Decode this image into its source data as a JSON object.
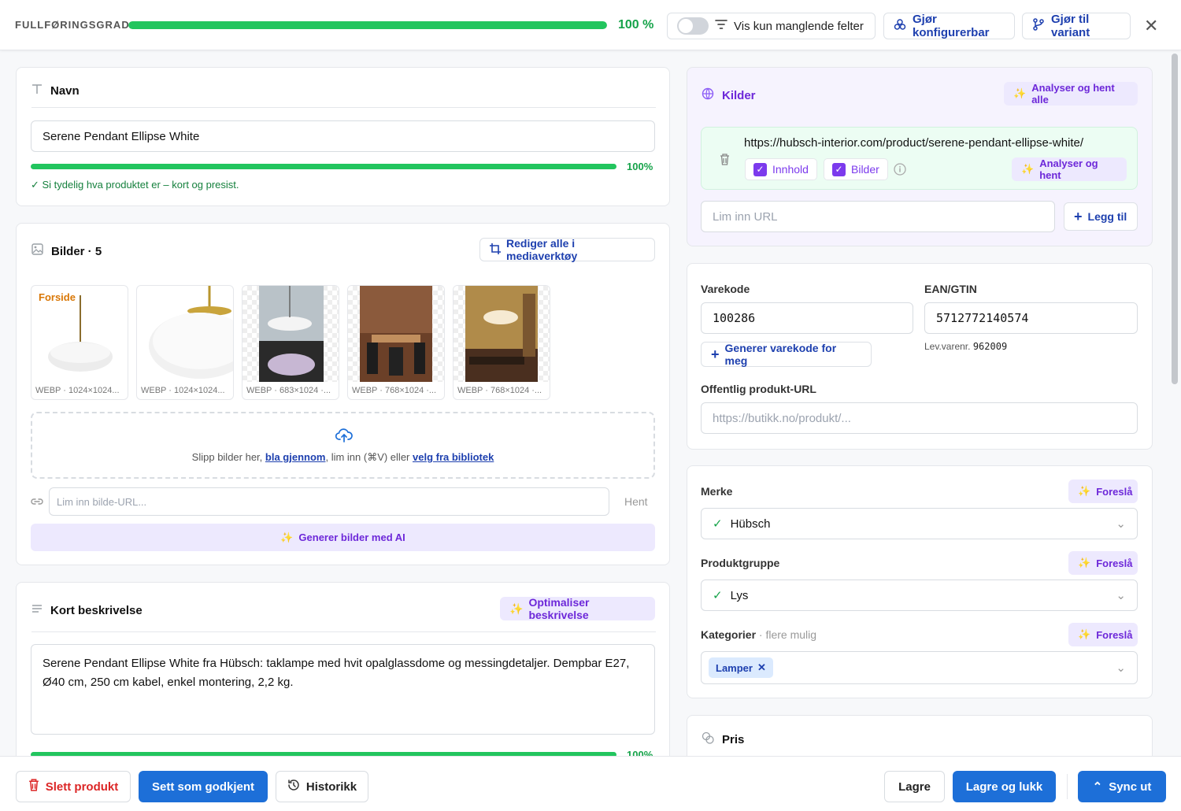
{
  "topbar": {
    "completion_label": "FULLFØRINGSGRAD",
    "completion_value": 1.0,
    "completion_pct": "100 %",
    "toggle_label": "Vis kun manglende felter",
    "configurable_label": "Gjør konfigurerbar",
    "variant_label": "Gjør til variant",
    "close_icon": "close-icon"
  },
  "name_card": {
    "title": "Navn",
    "value": "Serene Pendant Ellipse White",
    "score_pct": "100%",
    "hint": "✓ Si tydelig hva produktet er – kort og presist."
  },
  "images_card": {
    "title": "Bilder · 5",
    "edit_all_label": "Rediger alle i mediaverktøy",
    "front_badge": "Forside",
    "thumbs": [
      {
        "caption": "WEBP · 1024×1024..."
      },
      {
        "caption": "WEBP · 1024×1024..."
      },
      {
        "caption": "WEBP · 683×1024 ·..."
      },
      {
        "caption": "WEBP · 768×1024 ·..."
      },
      {
        "caption": "WEBP · 768×1024 ·..."
      }
    ],
    "drop_prefix": "Slipp bilder her, ",
    "drop_browse": "bla gjennom",
    "drop_middle": ", lim inn (⌘V) eller ",
    "drop_library": "velg fra bibliotek",
    "url_placeholder": "Lim inn bilde-URL...",
    "fetch_label": "Hent",
    "ai_label": "Generer bilder med AI"
  },
  "desc_card": {
    "title": "Kort beskrivelse",
    "optimize_label": "Optimaliser beskrivelse",
    "text": "Serene Pendant Ellipse White fra Hübsch: taklampe med hvit opalglassdome og messingdetaljer. Dempbar E27, Ø40 cm, 250 cm kabel, enkel montering, 2,2 kg.",
    "score_pct": "100%"
  },
  "sources_card": {
    "title": "Kilder",
    "analyze_all_label": "Analyser og hent alle",
    "source_url": "https://hubsch-interior.com/product/serene-pendant-ellipse-white/",
    "content_label": "Innhold",
    "images_label": "Bilder",
    "analyze_label": "Analyser og hent",
    "url_placeholder": "Lim inn URL",
    "add_label": "Legg til"
  },
  "codes_card": {
    "sku_label": "Varekode",
    "sku_value": "100286",
    "ean_label": "EAN/GTIN",
    "ean_value": "5712772140574",
    "generate_label": "Generer varekode for meg",
    "supplier_prefix": "Lev.varenr.",
    "supplier_value": "962009",
    "public_url_label": "Offentlig produkt-URL",
    "public_url_placeholder": "https://butikk.no/produkt/..."
  },
  "classify_card": {
    "brand_label": "Merke",
    "brand_value": "Hübsch",
    "group_label": "Produktgruppe",
    "group_value": "Lys",
    "categories_label": "Kategorier",
    "categories_sub": "· flere mulig",
    "suggest_label": "Foreslå",
    "category_chip": "Lamper"
  },
  "price_card": {
    "title": "Pris"
  },
  "footer": {
    "delete_label": "Slett produkt",
    "approve_label": "Sett som godkjent",
    "history_label": "Historikk",
    "save_label": "Lagre",
    "save_close_label": "Lagre og lukk",
    "sync_label": "Sync ut"
  },
  "colors": {
    "accent_blue": "#1d6fd8",
    "success_green": "#22c55e",
    "ai_purple": "#7c3aed",
    "danger_red": "#dc2626"
  }
}
